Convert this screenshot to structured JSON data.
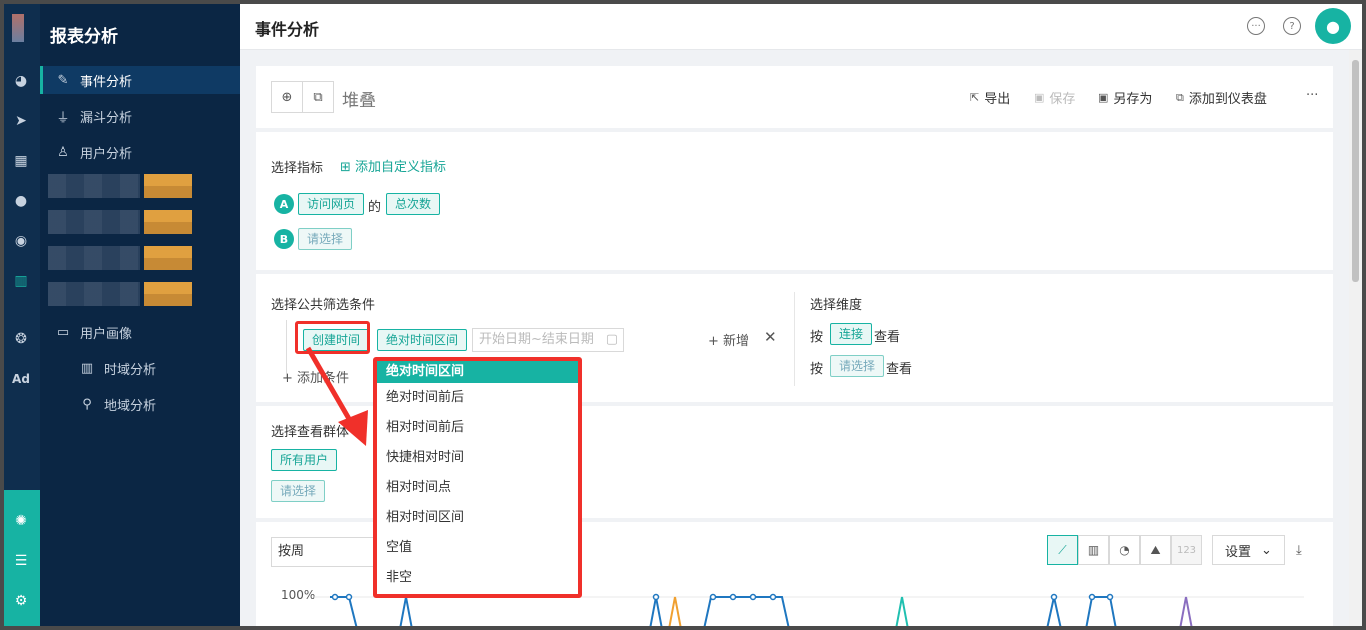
{
  "sidebar": {
    "title": "报表分析",
    "items": {
      "event": "事件分析",
      "funnel": "漏斗分析",
      "user": "用户分析",
      "portrait": "用户画像",
      "time_domain": "时域分析",
      "region": "地域分析"
    }
  },
  "header": {
    "page_title": "事件分析"
  },
  "toolbar": {
    "report_name": "堆叠",
    "export": "导出",
    "save": "保存",
    "save_as": "另存为",
    "add_dashboard": "添加到仪表盘",
    "more": "···"
  },
  "metrics": {
    "section_label": "选择指标",
    "add_custom": "添加自定义指标",
    "rows": [
      {
        "letter": "A",
        "event": "访问网页",
        "of": "的",
        "measure": "总次数"
      },
      {
        "letter": "B",
        "event": "请选择"
      }
    ]
  },
  "filters": {
    "section_label": "选择公共筛选条件",
    "field": "创建时间",
    "operator": "绝对时间区间",
    "date_placeholder": "开始日期~结束日期",
    "add_new": "新增",
    "add_condition": "添加条件"
  },
  "dimension": {
    "section_label": "选择维度",
    "by": "按",
    "view": "查看",
    "first": "连接",
    "second": "请选择"
  },
  "audience": {
    "section_label": "选择查看群体",
    "all_users": "所有用户",
    "choose": "请选择"
  },
  "dropdown": {
    "options": [
      "绝对时间区间",
      "绝对时间前后",
      "相对时间前后",
      "快捷相对时间",
      "相对时间点",
      "相对时间区间",
      "空值",
      "非空"
    ],
    "selected": 0
  },
  "chart_controls": {
    "period": "按周",
    "number_chip": "123",
    "settings": "设置",
    "y_top_label": "100%"
  },
  "colors": {
    "accent": "#17b3a3",
    "highlight": "#f0302a",
    "sidebar": "#0b2644"
  }
}
